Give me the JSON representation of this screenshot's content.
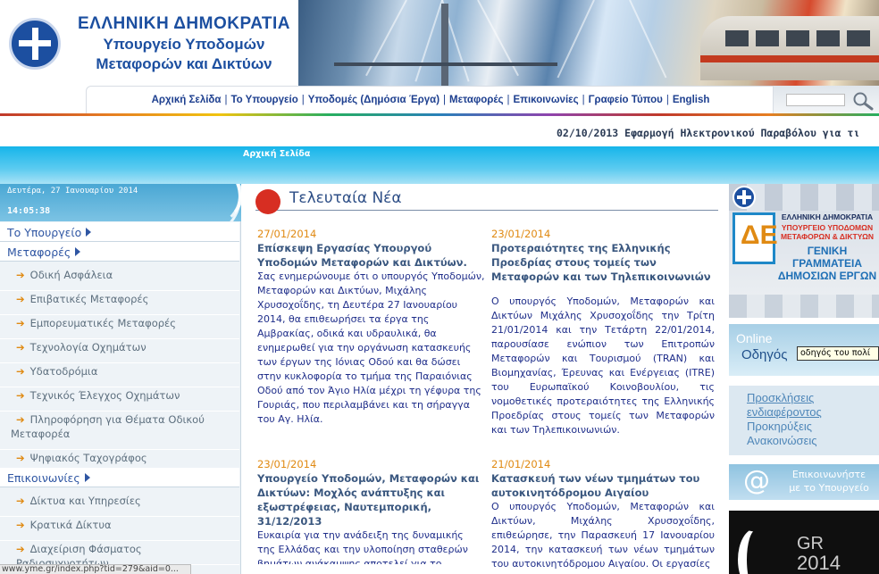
{
  "header": {
    "logo_line1": "ΕΛΛΗΝΙΚΗ ΔΗΜΟΚΡΑΤΙΑ",
    "logo_line2": "Υπουργείο Υποδομών",
    "logo_line3": "Μεταφορών και Δικτύων"
  },
  "nav": {
    "items": [
      "Αρχική Σελίδα",
      "Το Υπουργείο",
      "Υποδομές (Δημόσια Έργα)",
      "Μεταφορές",
      "Επικοινωνίες",
      "Γραφείο Τύπου",
      "English"
    ]
  },
  "search": {
    "value": "",
    "icon": "magnifier-icon"
  },
  "ticker": {
    "text": "02/10/2013 Εφαρμογή Ηλεκτρονικού Παραβόλου για τι"
  },
  "breadcrumb": "Αρχική Σελίδα",
  "sidebar": {
    "date": "Δευτέρα, 27 Ιανουαρίου 2014",
    "time": "14:05:38",
    "sections": [
      {
        "label": "Το Υπουργείο"
      },
      {
        "label": "Μεταφορές"
      },
      {
        "label": "Επικοινωνίες"
      }
    ],
    "transport_items": [
      "Οδική Ασφάλεια",
      "Επιβατικές Μεταφορές",
      "Εμπορευματικές Μεταφορές",
      "Τεχνολογία Οχημάτων",
      "Υδατοδρόμια",
      "Τεχνικός Έλεγχος Οχημάτων",
      "Πληροφόρηση για Θέματα Οδικού Μεταφορέα",
      "Ψηφιακός Ταχογράφος"
    ],
    "comm_items": [
      "Δίκτυα και Υπηρεσίες",
      "Κρατικά Δίκτυα",
      "Διαχείριση Φάσματος Ραδιοσυχνοτήτων"
    ]
  },
  "news": {
    "heading": "Τελευταία Νέα",
    "items": [
      {
        "date": "27/01/2014",
        "title": "Επίσκεψη Εργασίας Υπουργού Υποδομών Μεταφορών και Δικτύων.",
        "body": "Σας ενημερώνουμε ότι ο υπουργός Υποδομών, Μεταφορών και Δικτύων, Μιχάλης Χρυσοχοΐδης, τη Δευτέρα 27 Ιανουαρίου 2014, θα επιθεωρήσει τα έργα της Αμβρακίας, οδικά και υδραυλικά, θα ενημερωθεί για την οργάνωση κατασκευής των έργων της Ιόνιας Οδού και θα δώσει στην κυκλοφορία το τμήμα της Παραιόνιας Οδού από τον Άγιο Ηλία μέχρι τη γέφυρα της Γουριάς, που περιλαμβάνει και τη σήραγγα του Αγ. Ηλία."
      },
      {
        "date": "23/01/2014",
        "title": "Προτεραιότητες της Ελληνικής Προεδρίας στους τομείς των Μεταφορών και των Τηλεπικοινωνιών",
        "body": "Ο υπουργός Υποδομών, Μεταφορών και Δικτύων Μιχάλης Χρυσοχοΐδης την Τρίτη 21/01/2014 και την Τετάρτη 22/01/2014, παρουσίασε ενώπιον των Επιτροπών Μεταφορών και Τουρισμού (TRAN) και Βιομηχανίας, Έρευνας και Ενέργειας (ITRE) του Ευρωπαϊκού Κοινοβουλίου, τις νομοθετικές προτεραιότητες της Ελληνικής Προεδρίας στους τομείς των Μεταφορών και των Τηλεπικοινωνιών."
      },
      {
        "date": "23/01/2014",
        "title": "Υπουργείο Υποδομών, Μεταφορών και Δικτύων: Μοχλός ανάπτυξης και εξωστρέφειας, Ναυτεμπορική, 31/12/2013",
        "body": "Ευκαιρία για την ανάδειξη της δυναμικής της Ελλάδας και την υλοποίηση σταθερών βημάτων ανάκαμψης αποτελεί για το Υπουργείο Υποδομών, Μεταφορών και"
      },
      {
        "date": "21/01/2014",
        "title": "Κατασκευή των νέων τμημάτων του αυτοκινητόδρομου Αιγαίου",
        "body": "Ο υπουργός Υποδομών, Μεταφορών και Δικτύων, Μιχάλης Χρυσοχοΐδης, επιθεώρησε, την Παρασκευή 17 Ιανουαρίου 2014, την κατασκευή των νέων τμημάτων του αυτοκινητόδρομου Αιγαίου. Οι εργασίες"
      }
    ]
  },
  "right": {
    "gs_line1": "ΕΛΛΗΝΙΚΗ ΔΗΜΟΚΡΑΤΙΑ",
    "gs_line2a": "ΥΠΟΥΡΓΕΙΟ ΥΠΟΔΟΜΩΝ",
    "gs_line2b": "ΜΕΤΑΦΟΡΩΝ & ΔΙΚΤΥΩΝ",
    "gs_line3a": "ΓΕΝΙΚΗ",
    "gs_line3b": "ΓΡΑΜΜΑΤΕΙΑ",
    "gs_line3c": "ΔΗΜΟΣΙΩΝ ΕΡΓΩΝ",
    "gs_logo": "ΔΕ",
    "online_l1": "Online",
    "online_l2": "Οδηγός",
    "tooltip": "οδηγός του πολί",
    "calls": [
      "Προσκλήσεις",
      "ενδιαφέροντος",
      "Προκηρύξεις",
      "Ανακοινώσεις"
    ],
    "contact_l1": "Επικοινωνήστε",
    "contact_l2": "με το Υπουργείο",
    "contact_icon": "at-icon",
    "gr_l1": "GR",
    "gr_l2": "2014"
  },
  "status_bar": "www.yme.gr/index.php?tid=279&aid=0..."
}
